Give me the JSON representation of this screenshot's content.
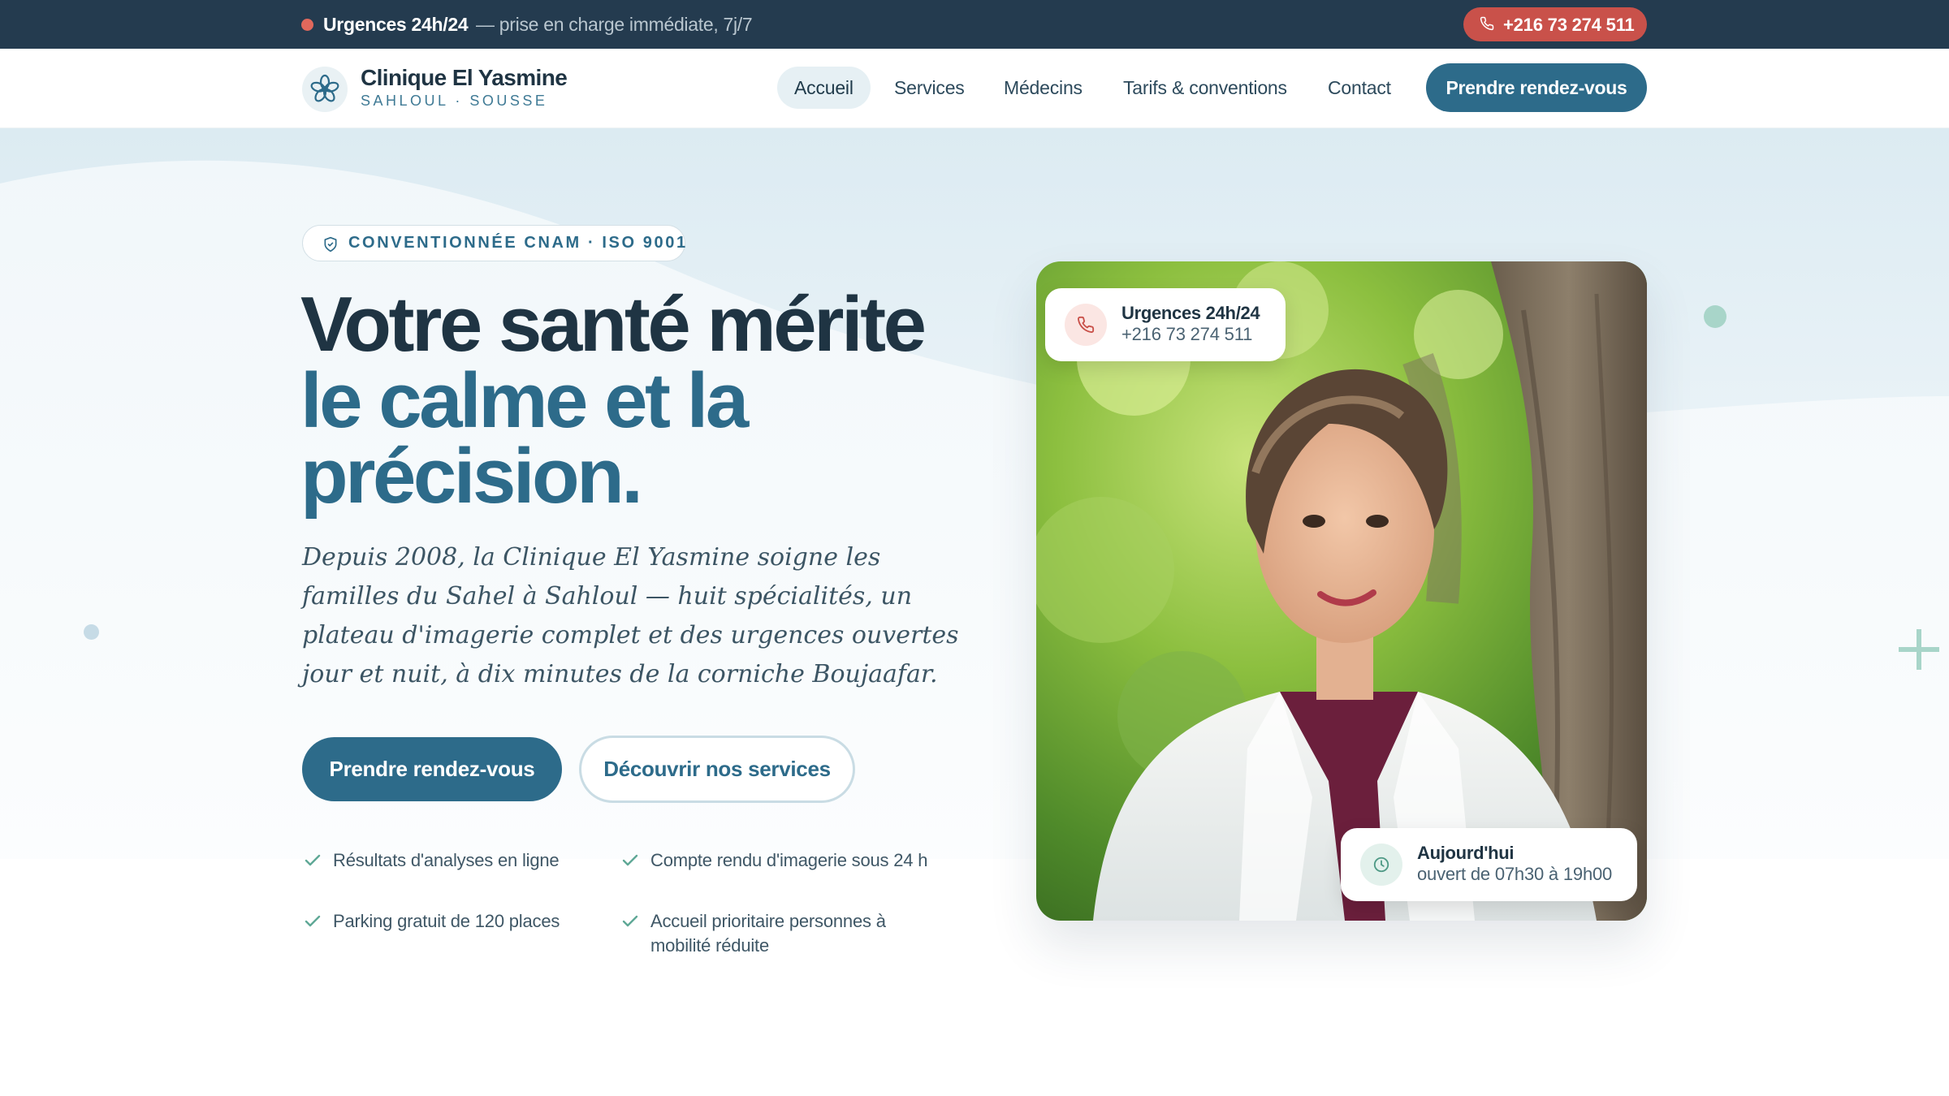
{
  "topbar": {
    "urgent_label": "Urgences 24h/24",
    "urgent_detail": "— prise en charge immédiate, 7j/7",
    "phone": "+216 73 274 511"
  },
  "header": {
    "brand_name": "Clinique El Yasmine",
    "brand_sub": "SAHLOUL · SOUSSE",
    "nav": [
      "Accueil",
      "Services",
      "Médecins",
      "Tarifs & conventions",
      "Contact"
    ],
    "active_nav": "Accueil",
    "cta": "Prendre rendez-vous"
  },
  "hero": {
    "badge": "CONVENTIONNÉE CNAM · ISO 9001",
    "title_line1": "Votre santé mérite",
    "title_line2": "le calme et la",
    "title_line3": "précision",
    "title_dot": ".",
    "lede": "Depuis 2008, la Clinique El Yasmine soigne les familles du Sahel à Sahloul — huit spécialités, un plateau d'imagerie complet et des urgences ouvertes jour et nuit, à dix minutes de la corniche Boujaafar.",
    "primary_cta": "Prendre rendez-vous",
    "secondary_cta": "Découvrir nos services",
    "features": [
      "Résultats d'analyses en ligne",
      "Compte rendu d'imagerie sous 24 h",
      "Parking gratuit de 120 places",
      "Accueil prioritaire personnes à mobilité réduite"
    ]
  },
  "photo_cards": {
    "urgent_title": "Urgences 24h/24",
    "urgent_phone": "+216 73 274 511",
    "today_title": "Aujourd'hui",
    "today_hours": "ouvert de 07h30 à 19h00"
  },
  "colors": {
    "primary": "#2d6b8a",
    "dark": "#243b4f",
    "urgent": "#c9514a",
    "accent_teal": "#9fcfc4"
  },
  "icons": [
    "flower-logo-icon",
    "phone-icon",
    "shield-icon",
    "check-icon",
    "clock-icon",
    "plus-icon"
  ]
}
